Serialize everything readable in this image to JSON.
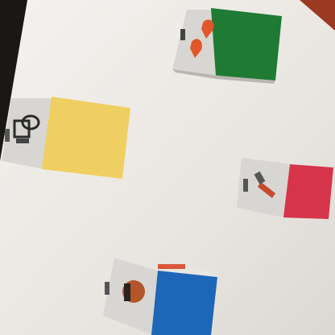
{
  "scene": {
    "surface_color": "#ece9e4",
    "blocks": [
      {
        "name": "green-block",
        "face_color": "#1f7a34",
        "icon": "heart-fruit-icon",
        "icon_color": "#e2562c"
      },
      {
        "name": "yellow-block",
        "face_color": "#f0cf62",
        "icon": "toilet-paper-icon",
        "icon_color": "#2a2a2a"
      },
      {
        "name": "red-block",
        "face_color": "#d6344a",
        "icon": "tool-icon",
        "icon_color": "#c74a2c"
      },
      {
        "name": "blue-block",
        "face_color": "#1e66b8",
        "icon": "jar-icon",
        "icon_color": "#b0562a"
      }
    ]
  }
}
